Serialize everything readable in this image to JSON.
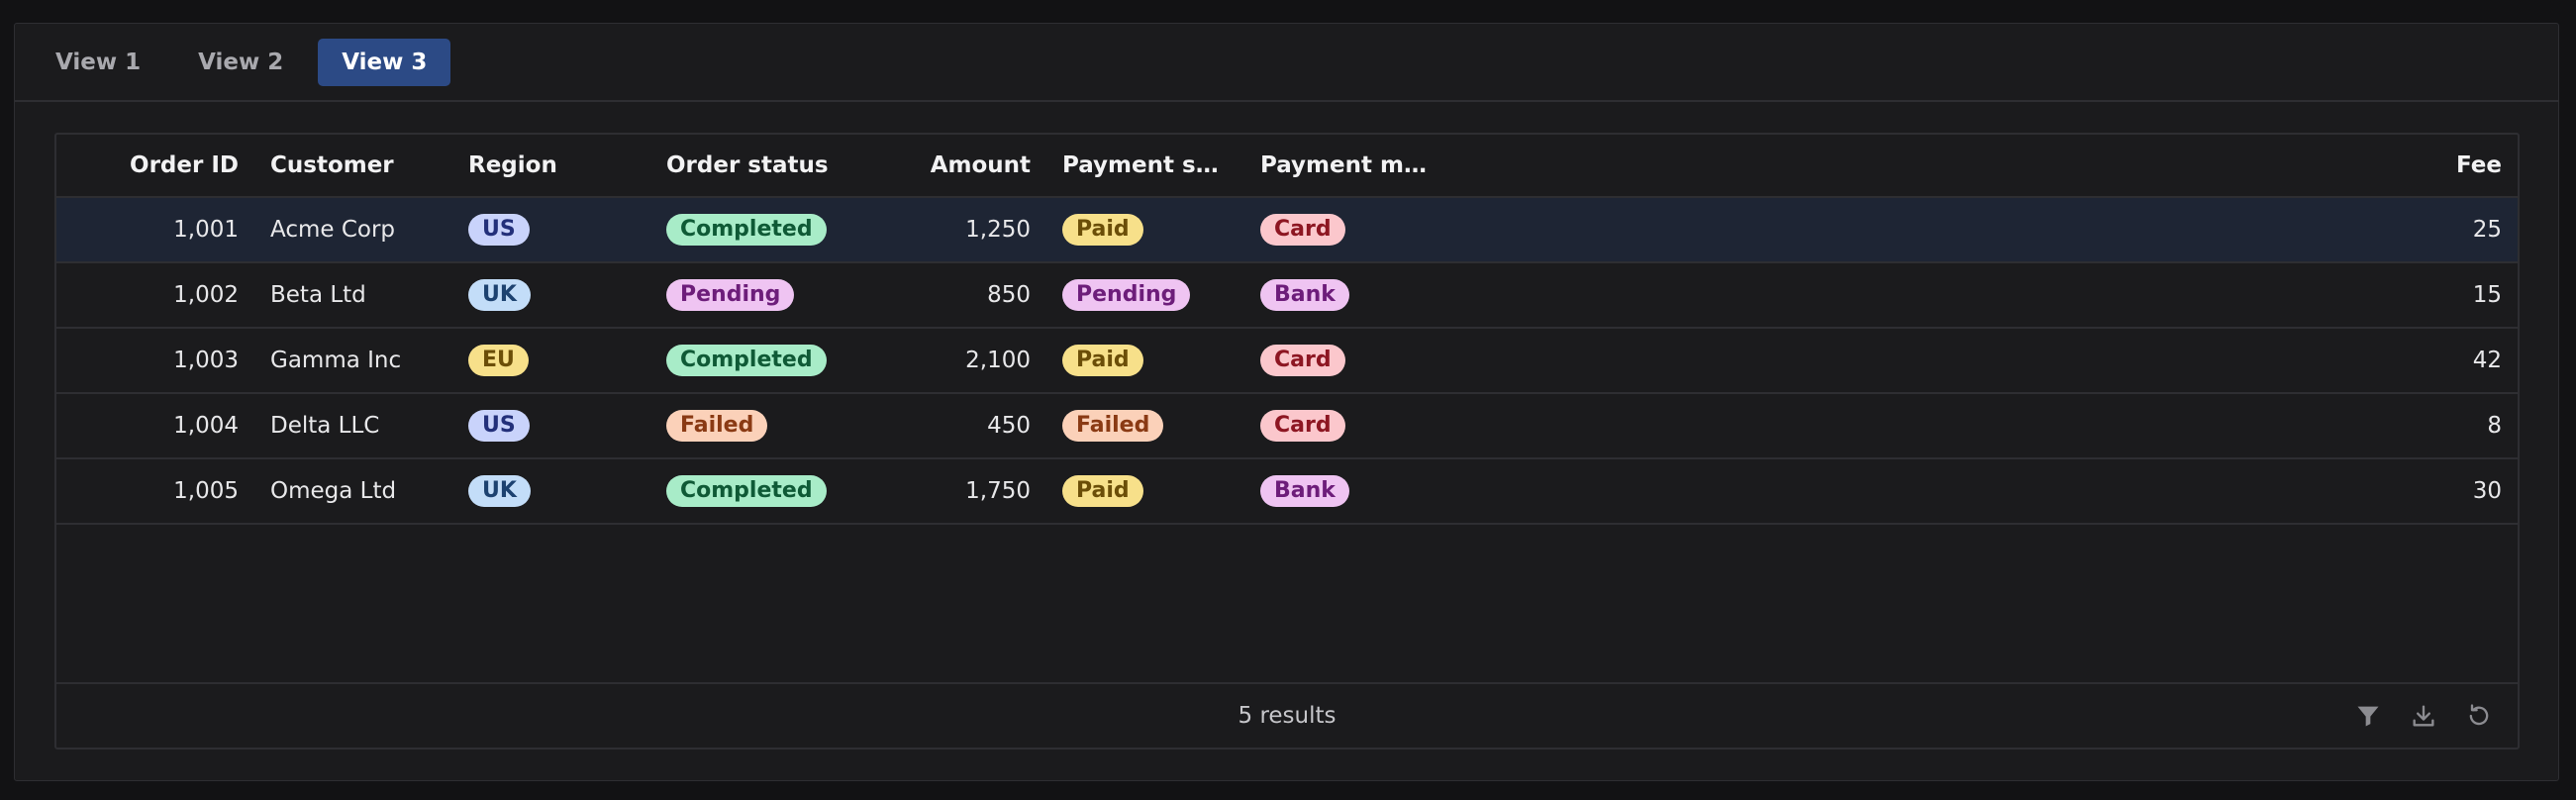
{
  "tabs": [
    "View 1",
    "View 2",
    "View 3"
  ],
  "active_tab": 2,
  "columns": [
    "Order ID",
    "Customer",
    "Region",
    "Order status",
    "Amount",
    "Payment sta...",
    "Payment me...",
    "Fee"
  ],
  "rows": [
    {
      "order_id": "1,001",
      "customer": "Acme Corp",
      "region": "US",
      "order_status": "Completed",
      "amount": "1,250",
      "payment_status": "Paid",
      "payment_method": "Card",
      "fee": "25"
    },
    {
      "order_id": "1,002",
      "customer": "Beta Ltd",
      "region": "UK",
      "order_status": "Pending",
      "amount": "850",
      "payment_status": "Pending",
      "payment_method": "Bank",
      "fee": "15"
    },
    {
      "order_id": "1,003",
      "customer": "Gamma Inc",
      "region": "EU",
      "order_status": "Completed",
      "amount": "2,100",
      "payment_status": "Paid",
      "payment_method": "Card",
      "fee": "42"
    },
    {
      "order_id": "1,004",
      "customer": "Delta LLC",
      "region": "US",
      "order_status": "Failed",
      "amount": "450",
      "payment_status": "Failed",
      "payment_method": "Card",
      "fee": "8"
    },
    {
      "order_id": "1,005",
      "customer": "Omega Ltd",
      "region": "UK",
      "order_status": "Completed",
      "amount": "1,750",
      "payment_status": "Paid",
      "payment_method": "Bank",
      "fee": "30"
    }
  ],
  "selected_row": 0,
  "pill_colors": {
    "US": {
      "bg": "#c9d3fb",
      "fg": "#23307a"
    },
    "UK": {
      "bg": "#c3ddf8",
      "fg": "#1d4270"
    },
    "EU": {
      "bg": "#f7e08a",
      "fg": "#6b4e08"
    },
    "Completed": {
      "bg": "#a8ecc8",
      "fg": "#0f5a36"
    },
    "Pending": {
      "bg": "#efc4f2",
      "fg": "#6d1d7a"
    },
    "Failed": {
      "bg": "#fbd1b9",
      "fg": "#8a3a14"
    },
    "Paid": {
      "bg": "#f7e08a",
      "fg": "#6b4e08"
    },
    "Card": {
      "bg": "#fbc7cc",
      "fg": "#8d1622"
    },
    "Bank": {
      "bg": "#efc4f2",
      "fg": "#6d1d7a"
    }
  },
  "footer": {
    "results_text": "5 results",
    "tools": [
      "filter-icon",
      "download-icon",
      "reset-icon"
    ]
  }
}
